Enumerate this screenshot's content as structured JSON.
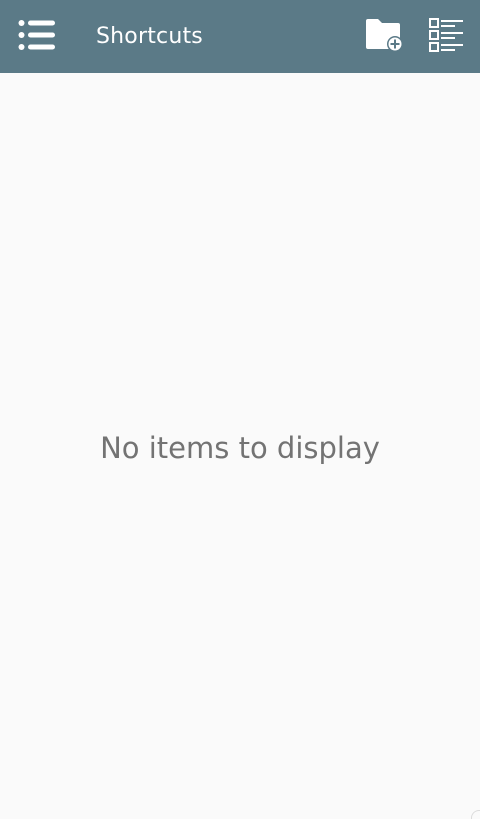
{
  "toolbar": {
    "title": "Shortcuts",
    "menu_icon": "list-menu-icon",
    "new_folder_icon": "folder-add-icon",
    "view_icon": "checklist-view-icon",
    "background_color": "#5b7a87"
  },
  "content": {
    "empty_message": "No items to display",
    "text_color": "#737373",
    "background_color": "#fafafa"
  }
}
